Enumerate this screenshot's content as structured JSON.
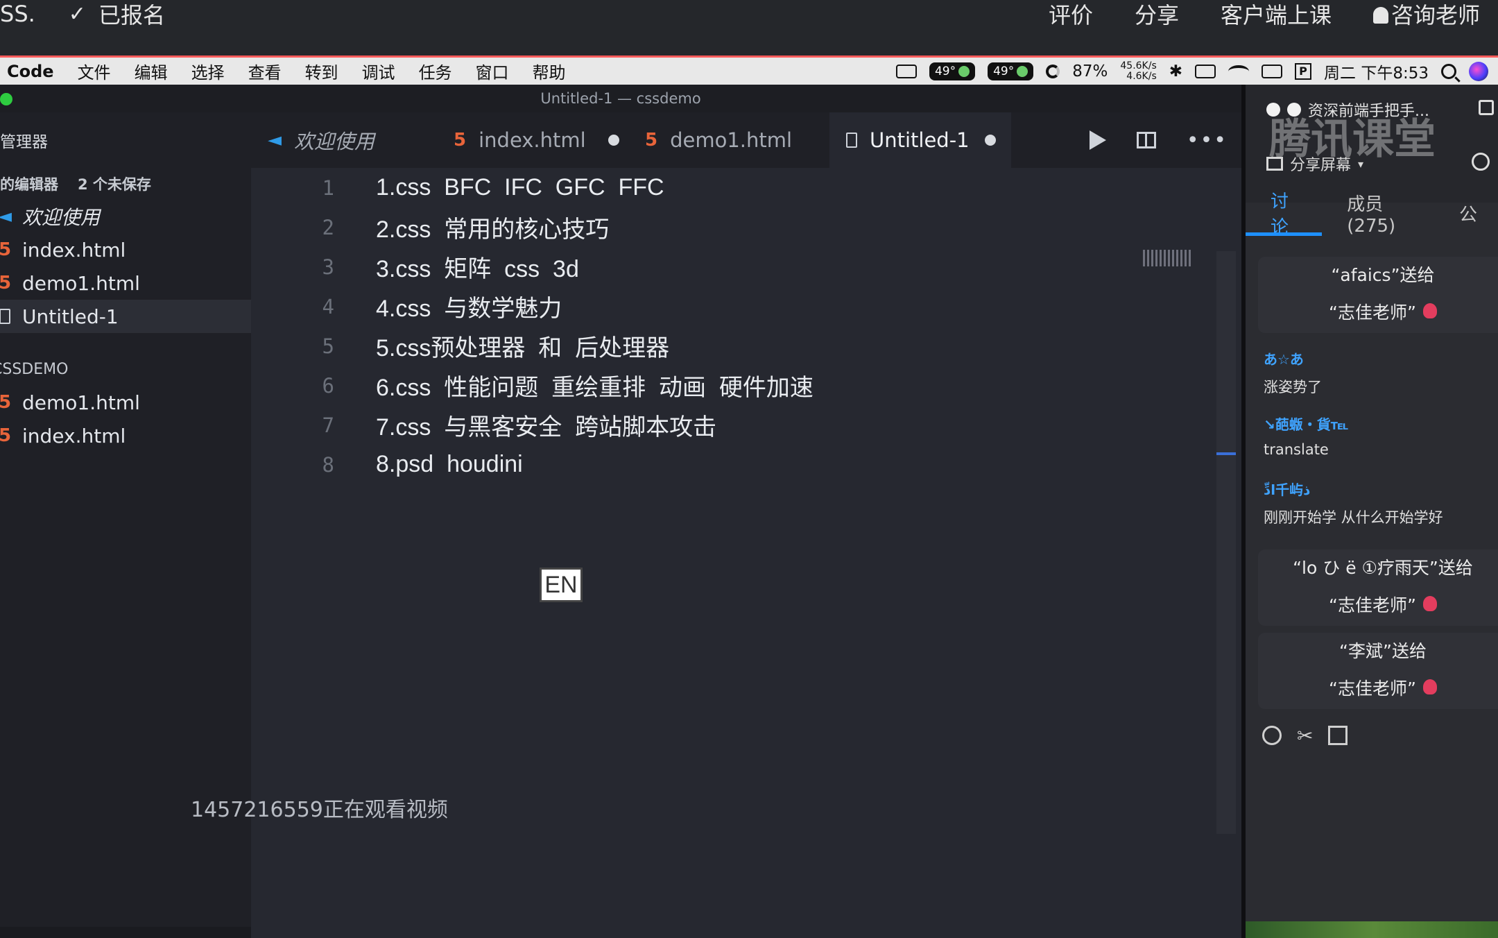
{
  "course_bar": {
    "left_text": "SS.",
    "enrolled": "已报名",
    "links": [
      "评价",
      "分享",
      "客户端上课"
    ],
    "consult": "咨询老师"
  },
  "menu_bar": {
    "app": "Code",
    "items": [
      "文件",
      "编辑",
      "选择",
      "查看",
      "转到",
      "调试",
      "任务",
      "窗口",
      "帮助"
    ],
    "temp1": "49°",
    "temp2": "49°",
    "battery_pct": "87%",
    "net_up": "45.6K/s",
    "net_down": "4.6K/s",
    "clock": "周二 下午8:53"
  },
  "editor": {
    "window_title": "Untitled-1 — cssdemo",
    "explorer_title": "资源管理器",
    "open_editors_label": "打开的编辑器",
    "unsaved": "2 个未保存",
    "open_editors": [
      {
        "label": "欢迎使用",
        "icon": "vscode-icon"
      },
      {
        "label": "index.html",
        "icon": "html5-icon"
      },
      {
        "label": "demo1.html",
        "icon": "html5-icon"
      },
      {
        "label": "Untitled-1",
        "icon": "file-icon"
      }
    ],
    "project_label": "CSSDEMO",
    "project_files": [
      {
        "label": "demo1.html",
        "icon": "html5-icon"
      },
      {
        "label": "index.html",
        "icon": "html5-icon"
      }
    ],
    "tabs": [
      {
        "label": "欢迎使用",
        "modified": false
      },
      {
        "label": "index.html",
        "modified": true
      },
      {
        "label": "demo1.html",
        "modified": false
      },
      {
        "label": "Untitled-1",
        "modified": true
      }
    ],
    "lines": [
      "1.css  BFC  IFC  GFC  FFC",
      "2.css  常用的核心技巧",
      "3.css  矩阵  css  3d",
      "4.css  与数学魅力",
      "5.css预处理器  和  后处理器",
      "6.css  性能问题  重绘重排  动画  硬件加速",
      "7.css  与黑客安全  跨站脚本攻击",
      "8.psd  houdini"
    ],
    "ime_badge": "EN",
    "watermark": "1457216559正在观看视频"
  },
  "panel": {
    "course_title": "资深前端手把手...",
    "logo_text": "腾讯课堂",
    "share_screen": "分享屏幕",
    "tabs": [
      "讨论",
      "成员(275)",
      "公"
    ],
    "gift1_line1": "“afaics”送给",
    "gift1_line2": "“志佳老师”",
    "chat1_name": "あ☆あ",
    "chat1_msg": "涨姿势了",
    "chat2_name": "↘葩蝂・貨℡",
    "chat2_msg": "translate",
    "chat3_name": "ادِّ千屿ذ",
    "chat3_msg": "刚刚开始学 从什么开始学好",
    "gift2_line1": "“ⅼo ひ ë ①疗雨天”送给",
    "gift2_line2": "“志佳老师”",
    "gift3_line1": "“李斌”送给",
    "gift3_line2": "“志佳老师”"
  },
  "colors": {
    "accent": "#1e90ff",
    "html_icon": "#e8643a",
    "vscode_icon": "#2f9be8"
  }
}
